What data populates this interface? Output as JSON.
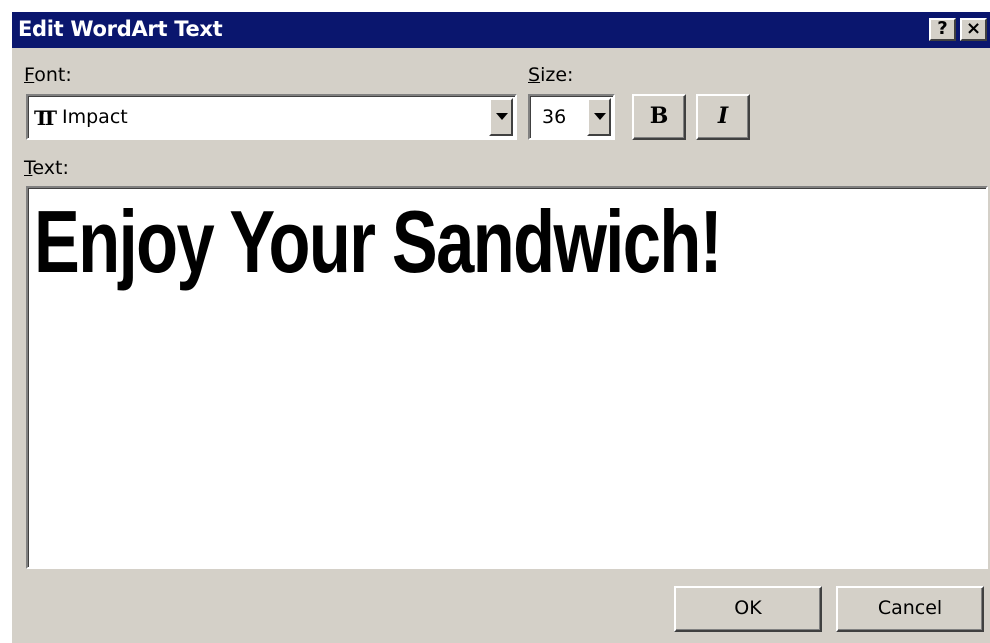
{
  "window": {
    "title": "Edit WordArt Text",
    "help_label": "?",
    "close_label": "×"
  },
  "font": {
    "label_accel": "F",
    "label_rest": "ont:",
    "value": "Impact",
    "icon": "truetype-font-icon"
  },
  "size": {
    "label_accel": "S",
    "label_rest": "ize:",
    "value": "36"
  },
  "style_buttons": {
    "bold_label": "B",
    "italic_label": "I"
  },
  "text": {
    "label_accel": "T",
    "label_rest": "ext:",
    "value": "Enjoy Your Sandwich!"
  },
  "actions": {
    "ok_label": "OK",
    "cancel_label": "Cancel"
  },
  "colors": {
    "titlebar": "#0a166e",
    "dialog_face": "#d4d0c8"
  }
}
